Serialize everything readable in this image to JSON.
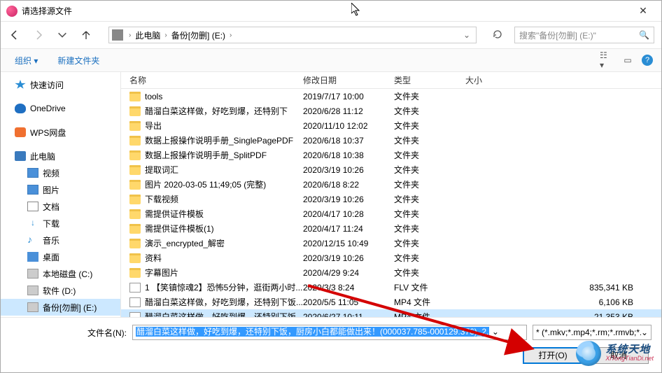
{
  "title": "请选择源文件",
  "breadcrumb": {
    "seg1": "此电脑",
    "seg2": "备份[勿删] (E:)"
  },
  "search_placeholder": "搜索\"备份[勿删] (E:)\"",
  "toolbar": {
    "organize": "组织",
    "newfolder": "新建文件夹"
  },
  "columns": {
    "name": "名称",
    "date": "修改日期",
    "type": "类型",
    "size": "大小"
  },
  "sidebar": {
    "quick": "快速访问",
    "onedrive": "OneDrive",
    "wps": "WPS网盘",
    "thispc": "此电脑",
    "video": "视频",
    "pictures": "图片",
    "documents": "文档",
    "downloads": "下载",
    "music": "音乐",
    "desktop": "桌面",
    "diskc": "本地磁盘 (C:)",
    "diskd": "软件 (D:)",
    "diske": "备份[勿删] (E:)"
  },
  "files": [
    {
      "icon": "folder",
      "name": "tools",
      "date": "2019/7/17 10:00",
      "type": "文件夹",
      "size": ""
    },
    {
      "icon": "folder",
      "name": "醋溜白菜这样做，好吃到爆，还特别下",
      "date": "2020/6/28 11:12",
      "type": "文件夹",
      "size": ""
    },
    {
      "icon": "folder",
      "name": "导出",
      "date": "2020/11/10 12:02",
      "type": "文件夹",
      "size": ""
    },
    {
      "icon": "folder",
      "name": "数据上报操作说明手册_SinglePagePDF",
      "date": "2020/6/18 10:37",
      "type": "文件夹",
      "size": ""
    },
    {
      "icon": "folder",
      "name": "数据上报操作说明手册_SplitPDF",
      "date": "2020/6/18 10:38",
      "type": "文件夹",
      "size": ""
    },
    {
      "icon": "folder",
      "name": "提取词汇",
      "date": "2020/3/19 10:26",
      "type": "文件夹",
      "size": ""
    },
    {
      "icon": "folder",
      "name": "图片 2020-03-05 11;49;05 (完整)",
      "date": "2020/6/18 8:22",
      "type": "文件夹",
      "size": ""
    },
    {
      "icon": "folder",
      "name": "下载视频",
      "date": "2020/3/19 10:26",
      "type": "文件夹",
      "size": ""
    },
    {
      "icon": "folder",
      "name": "需提供证件模板",
      "date": "2020/4/17 10:28",
      "type": "文件夹",
      "size": ""
    },
    {
      "icon": "folder",
      "name": "需提供证件模板(1)",
      "date": "2020/4/17 11:24",
      "type": "文件夹",
      "size": ""
    },
    {
      "icon": "folder",
      "name": "演示_encrypted_解密",
      "date": "2020/12/15 10:49",
      "type": "文件夹",
      "size": ""
    },
    {
      "icon": "folder",
      "name": "资料",
      "date": "2020/3/19 10:26",
      "type": "文件夹",
      "size": ""
    },
    {
      "icon": "folder",
      "name": "字幕图片",
      "date": "2020/4/29 9:24",
      "type": "文件夹",
      "size": ""
    },
    {
      "icon": "file",
      "name": "1 【笑镇惊魂2】恐怖5分钟，逛街两小时...",
      "date": "2020/3/3 8:24",
      "type": "FLV 文件",
      "size": "835,341 KB"
    },
    {
      "icon": "file",
      "name": "醋溜白菜这样做，好吃到爆，还特别下饭...",
      "date": "2020/5/5 11:05",
      "type": "MP4 文件",
      "size": "6,106 KB"
    },
    {
      "icon": "file",
      "name": "醋溜白菜这样做，好吃到爆，还特别下饭...",
      "date": "2020/6/27 10:11",
      "type": "MP4 文件",
      "size": "21,353 KB",
      "selected": true
    }
  ],
  "filename_label": "文件名(N):",
  "filename_value": "醋溜白菜这样做，好吃到爆，还特别下饭，厨房小白都能做出来！(000037.785-000129.376)_2.",
  "filter": "* (*.mkv;*.mp4;*.rm;*.rmvb;*.f",
  "buttons": {
    "open": "打开(O)",
    "cancel": "取消"
  },
  "watermark": {
    "cn": "系统天地",
    "en": "XiTongTianDi.net"
  }
}
